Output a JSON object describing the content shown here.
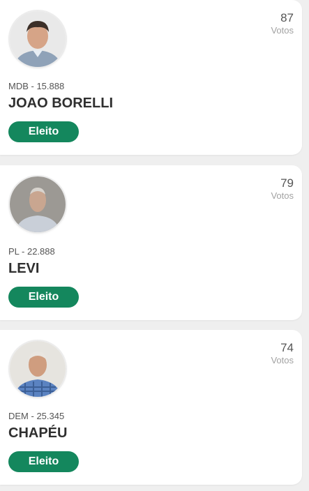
{
  "candidates": [
    {
      "party": "MDB - 15.888",
      "name": "JOAO BORELLI",
      "votes": "87",
      "votes_label": "Votos",
      "status": "Eleito"
    },
    {
      "party": "PL - 22.888",
      "name": "LEVI",
      "votes": "79",
      "votes_label": "Votos",
      "status": "Eleito"
    },
    {
      "party": "DEM - 25.345",
      "name": "CHAPÉU",
      "votes": "74",
      "votes_label": "Votos",
      "status": "Eleito"
    }
  ],
  "colors": {
    "status_badge": "#14875d",
    "page_background": "#efefef",
    "card_background": "#ffffff"
  }
}
